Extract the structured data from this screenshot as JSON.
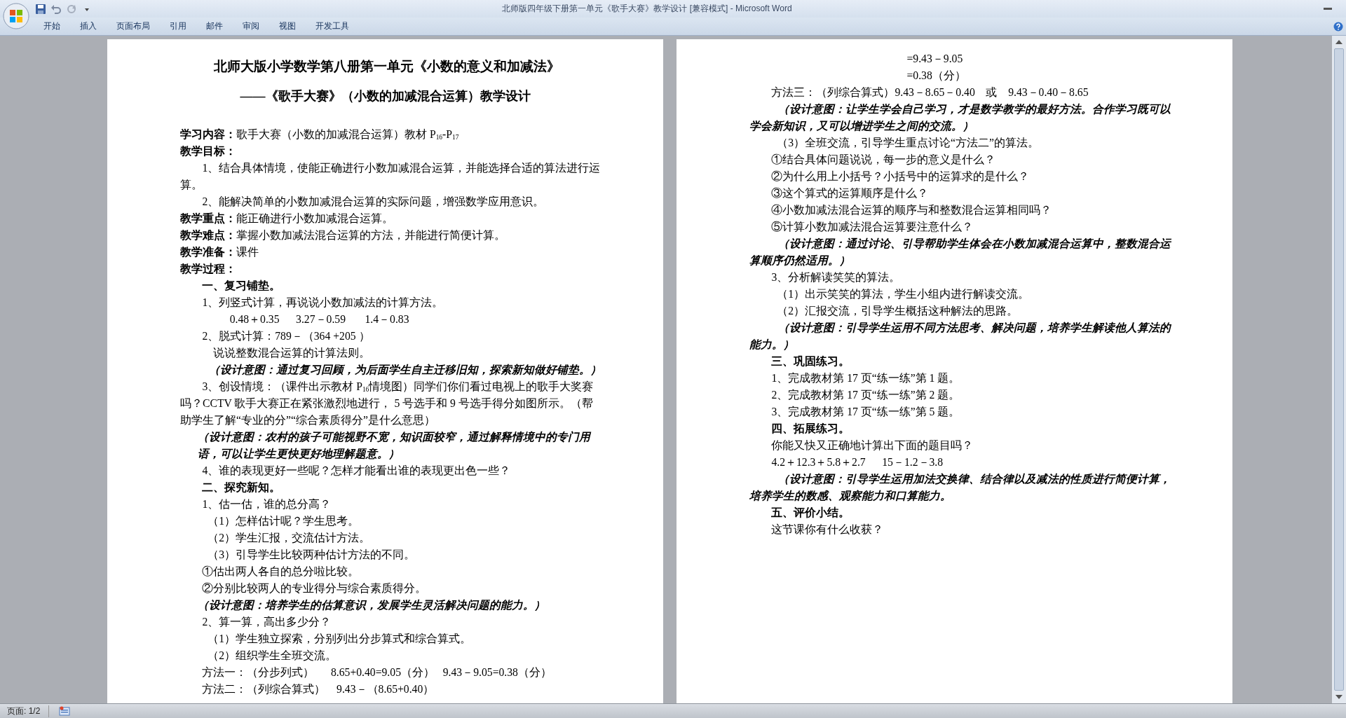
{
  "window": {
    "title": "北师版四年级下册第一单元《歌手大赛》教学设计 [兼容模式] - Microsoft Word"
  },
  "ribbon": {
    "tabs": [
      {
        "label": "开始"
      },
      {
        "label": "插入"
      },
      {
        "label": "页面布局"
      },
      {
        "label": "引用"
      },
      {
        "label": "邮件"
      },
      {
        "label": "审阅"
      },
      {
        "label": "视图"
      },
      {
        "label": "开发工具"
      }
    ]
  },
  "pages": [
    {
      "paragraphs": [
        {
          "kind": "title",
          "text": "北师大版小学数学第八册第一单元《小数的意义和加减法》"
        },
        {
          "kind": "subtitle",
          "text": "——《歌手大赛》（小数的加减混合运算）教学设计"
        },
        {
          "kind": "blank"
        },
        {
          "kind": "flush",
          "text": "**学习内容：**歌手大赛（小数的加减混合运算）教材 P$_{16}$-P$_{17}$"
        },
        {
          "kind": "heading",
          "text": "教学目标："
        },
        {
          "kind": "indent",
          "text": "1、结合具体情境，使能正确进行小数加减混合运算，并能选择合适的算法进行运算。"
        },
        {
          "kind": "indent",
          "text": "2、能解决简单的小数加减混合运算的实际问题，增强数学应用意识。"
        },
        {
          "kind": "flush",
          "text": "**教学重点：**能正确进行小数加减混合运算。"
        },
        {
          "kind": "flush",
          "text": "**教学难点：**掌握小数加减法混合运算的方法，并能进行简便计算。"
        },
        {
          "kind": "flush",
          "text": "**教学准备：**课件"
        },
        {
          "kind": "heading",
          "text": "教学过程："
        },
        {
          "kind": "section",
          "text": "一、复习铺垫。"
        },
        {
          "kind": "indent",
          "text": "1、列竖式计算，再说说小数加减法的计算方法。"
        },
        {
          "kind": "formula",
          "text": "0.48＋0.35      3.27－0.59       1.4－0.83"
        },
        {
          "kind": "indent",
          "text": "2、脱式计算：789－（364 +205 ）"
        },
        {
          "kind": "indent3",
          "text": "说说整数混合运算的计算法则。"
        },
        {
          "kind": "note",
          "text": "（设计意图：通过复习回顾，为后面学生自主迁移旧知，探索新知做好铺垫。）"
        },
        {
          "kind": "indent",
          "text": "3、创设情境：（课件出示教材 P$_{16}$情境图）同学们你们看过电视上的歌手大奖赛吗？CCTV 歌手大赛正在紧张激烈地进行， 5 号选手和 9 号选手得分如图所示。（帮助学生了解“专业的分”“综合素质得分”是什么意思）"
        },
        {
          "kind": "note-hang",
          "text": "（设计意图：农村的孩子可能视野不宽，知识面较窄，通过解释情境中的专门用语，可以让学生更快更好地理解题意。）"
        },
        {
          "kind": "indent",
          "text": "4、谁的表现更好一些呢？怎样才能看出谁的表现更出色一些？"
        },
        {
          "kind": "section",
          "text": "二、探究新知。"
        },
        {
          "kind": "indent",
          "text": "1、估一估，谁的总分高？"
        },
        {
          "kind": "sub",
          "text": "（1）怎样估计呢？学生思考。"
        },
        {
          "kind": "sub",
          "text": "（2）学生汇报，交流估计方法。"
        },
        {
          "kind": "sub",
          "text": "（3）引导学生比较两种估计方法的不同。"
        },
        {
          "kind": "indent",
          "text": "①估出两人各自的总分啦比较。"
        },
        {
          "kind": "indent",
          "text": "②分别比较两人的专业得分与综合素质得分。"
        },
        {
          "kind": "note-hang",
          "text": "（设计意图：培养学生的估算意识，发展学生灵活解决问题的能力。）"
        },
        {
          "kind": "indent",
          "text": "2、算一算，高出多少分？"
        },
        {
          "kind": "sub",
          "text": "（1）学生独立探索，分别列出分步算式和综合算式。"
        },
        {
          "kind": "sub",
          "text": "（2）组织学生全班交流。"
        },
        {
          "kind": "indent",
          "text": "方法一：（分步列式）      8.65+0.40=9.05（分）   9.43－9.05=0.38（分）"
        },
        {
          "kind": "indent",
          "text": "方法二：（列综合算式）    9.43－（8.65+0.40）"
        }
      ]
    },
    {
      "paragraphs": [
        {
          "kind": "cont",
          "text": "=9.43－9.05"
        },
        {
          "kind": "cont",
          "text": "=0.38（分）"
        },
        {
          "kind": "indent",
          "text": "方法三：（列综合算式）9.43－8.65－0.40    或    9.43－0.40－8.65"
        },
        {
          "kind": "note",
          "text": "（设计意图：让学生学会自己学习，才是数学教学的最好方法。合作学习既可以学会新知识，又可以增进学生之间的交流。）"
        },
        {
          "kind": "sub",
          "text": "（3）全班交流，引导学生重点讨论“方法二”的算法。"
        },
        {
          "kind": "indent",
          "text": "①结合具体问题说说，每一步的意义是什么？"
        },
        {
          "kind": "indent",
          "text": "②为什么用上小括号？小括号中的运算求的是什么？"
        },
        {
          "kind": "indent",
          "text": "③这个算式的运算顺序是什么？"
        },
        {
          "kind": "indent",
          "text": "④小数加减法混合运算的顺序与和整数混合运算相同吗？"
        },
        {
          "kind": "indent",
          "text": "⑤计算小数加减法混合运算要注意什么？"
        },
        {
          "kind": "note",
          "text": "（设计意图：通过讨论、引导帮助学生体会在小数加减混合运算中，整数混合运算顺序仍然适用。）"
        },
        {
          "kind": "indent",
          "text": "3、分析解读笑笑的算法。"
        },
        {
          "kind": "sub",
          "text": "（1）出示笑笑的算法，学生小组内进行解读交流。"
        },
        {
          "kind": "sub",
          "text": "（2）汇报交流，引导学生概括这种解法的思路。"
        },
        {
          "kind": "note",
          "text": "（设计意图：引导学生运用不同方法思考、解决问题，培养学生解读他人算法的能力。）"
        },
        {
          "kind": "section",
          "text": "三、巩固练习。"
        },
        {
          "kind": "indent",
          "text": "1、完成教材第 17 页“练一练”第 1 题。"
        },
        {
          "kind": "indent",
          "text": "2、完成教材第 17 页“练一练”第 2 题。"
        },
        {
          "kind": "indent",
          "text": "3、完成教材第 17 页“练一练”第 5 题。"
        },
        {
          "kind": "section",
          "text": "四、拓展练习。"
        },
        {
          "kind": "indent",
          "text": "你能又快又正确地计算出下面的题目吗？"
        },
        {
          "kind": "indent",
          "text": "4.2＋12.3＋5.8＋2.7      15－1.2－3.8"
        },
        {
          "kind": "note",
          "text": "（设计意图：引导学生运用加法交换律、结合律以及减法的性质进行简便计算，培养学生的数感、观察能力和口算能力。"
        },
        {
          "kind": "section",
          "text": "五、评价小结。"
        },
        {
          "kind": "indent",
          "text": "这节课你有什么收获？"
        }
      ]
    }
  ],
  "status_bar": {
    "page": "页面: 1/2"
  }
}
